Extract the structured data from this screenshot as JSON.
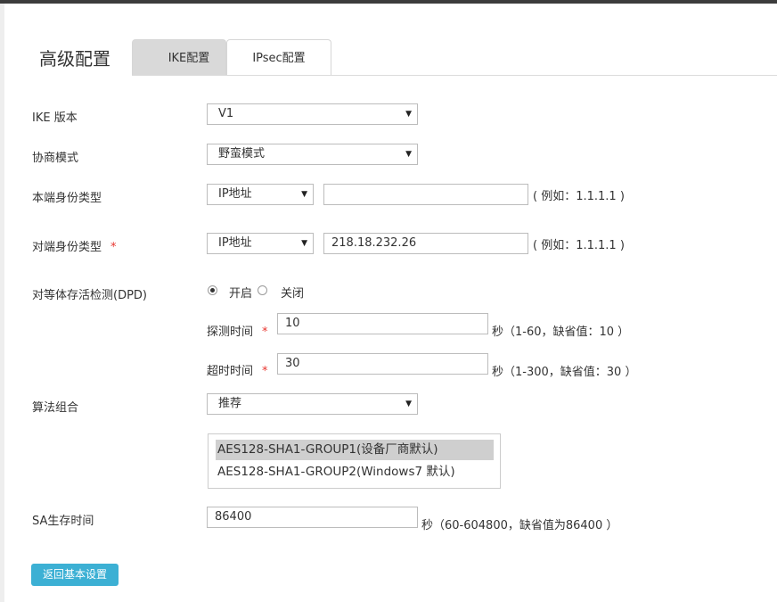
{
  "header": {
    "title": "高级配置",
    "tabs": [
      {
        "label": "IKE配置",
        "active": true
      },
      {
        "label": "IPsec配置",
        "active": false
      }
    ]
  },
  "form": {
    "ike_version": {
      "label": "IKE 版本",
      "value": "V1"
    },
    "negotiation_mode": {
      "label": "协商模式",
      "value": "野蛮模式"
    },
    "local_id": {
      "label": "本端身份类型",
      "type": "IP地址",
      "value": "",
      "hint": "( 例如：1.1.1.1 )"
    },
    "peer_id": {
      "label": "对端身份类型",
      "required_mark": "*",
      "type": "IP地址",
      "value": "218.18.232.26",
      "hint": "( 例如：1.1.1.1 )"
    },
    "dpd": {
      "label": "对等体存活检测(DPD)",
      "options": [
        {
          "label": "开启",
          "checked": true
        },
        {
          "label": "关闭",
          "checked": false
        }
      ],
      "probe_time": {
        "label": "探测时间",
        "required_mark": "*",
        "value": "10",
        "hint": "秒（1-60，缺省值：10 ）"
      },
      "timeout": {
        "label": "超时时间",
        "required_mark": "*",
        "value": "30",
        "hint": "秒（1-300，缺省值：30 ）"
      }
    },
    "algorithm": {
      "label": "算法组合",
      "value": "推荐",
      "list": [
        {
          "label": "AES128-SHA1-GROUP1(设备厂商默认)",
          "selected": true
        },
        {
          "label": "AES128-SHA1-GROUP2(Windows7 默认)",
          "selected": false
        }
      ]
    },
    "sa_lifetime": {
      "label": "SA生存时间",
      "value": "86400",
      "hint": "秒（60-604800，缺省值为86400 ）"
    }
  },
  "footer": {
    "back_button": "返回基本设置"
  },
  "icons": {
    "caret": "caret-down-icon"
  },
  "colors": {
    "accent": "#3cb0d4",
    "required": "#e8352f",
    "tab_active_bg": "#d9d9d9"
  }
}
